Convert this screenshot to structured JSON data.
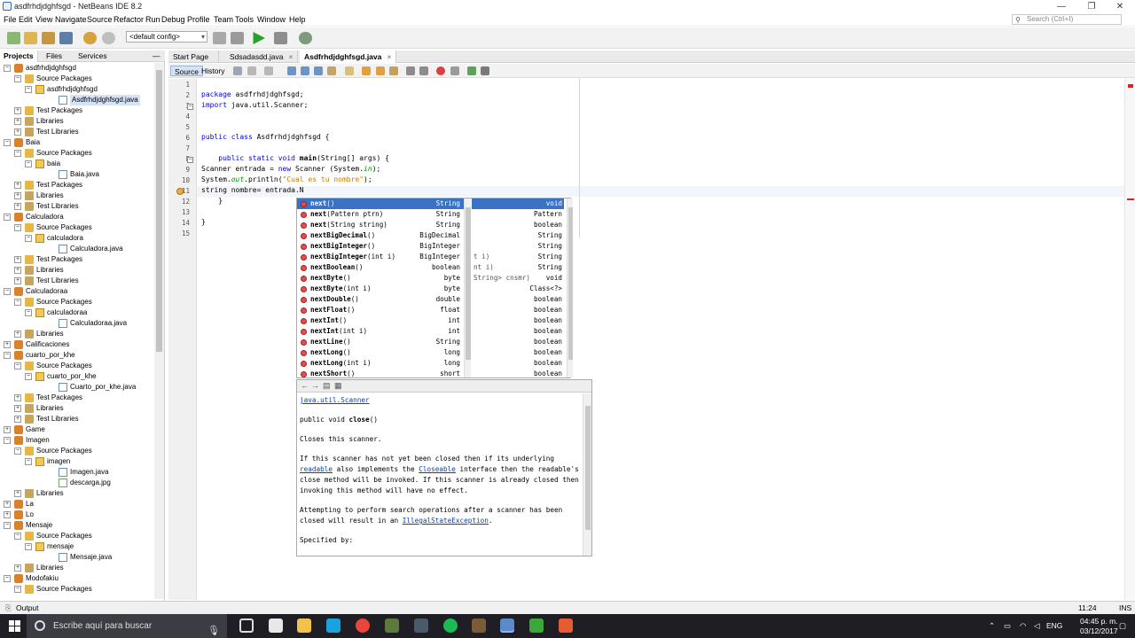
{
  "window": {
    "title": "asdfrhdjdghfsgd - NetBeans IDE 8.2",
    "minimize": "—",
    "maximize": "❐",
    "close": "✕"
  },
  "menu": [
    "File",
    "Edit",
    "View",
    "Navigate",
    "Source",
    "Refactor",
    "Run",
    "Debug",
    "Profile",
    "Team",
    "Tools",
    "Window",
    "Help"
  ],
  "search": {
    "placeholder": "Search (Ctrl+I)"
  },
  "toolbar": {
    "config": "<default config>"
  },
  "left_tabs": [
    "Projects",
    "Files",
    "Services"
  ],
  "left_tabs_close": "—",
  "tree": [
    {
      "label": "asdfrhdjdghfsgd",
      "icon": "proj",
      "toggle": "−"
    },
    {
      "label": "Source Packages",
      "icon": "pkgs",
      "toggle": "−"
    },
    {
      "label": "asdfrhdjdghfsgd",
      "icon": "pkg",
      "toggle": "−"
    },
    {
      "label": "Asdfrhdjdghfsgd.java",
      "icon": "java",
      "selected": true
    },
    {
      "label": "Test Packages",
      "icon": "pkgs",
      "toggle": "+"
    },
    {
      "label": "Libraries",
      "icon": "lib",
      "toggle": "+"
    },
    {
      "label": "Test Libraries",
      "icon": "lib",
      "toggle": "+"
    },
    {
      "label": "Baia",
      "icon": "proj",
      "toggle": "−"
    },
    {
      "label": "Source Packages",
      "icon": "pkgs",
      "toggle": "−"
    },
    {
      "label": "baia",
      "icon": "pkg",
      "toggle": "−"
    },
    {
      "label": "Baia.java",
      "icon": "java"
    },
    {
      "label": "Test Packages",
      "icon": "pkgs",
      "toggle": "+"
    },
    {
      "label": "Libraries",
      "icon": "lib",
      "toggle": "+"
    },
    {
      "label": "Test Libraries",
      "icon": "lib",
      "toggle": "+"
    },
    {
      "label": "Calculadora",
      "icon": "proj",
      "toggle": "−"
    },
    {
      "label": "Source Packages",
      "icon": "pkgs",
      "toggle": "−"
    },
    {
      "label": "calculadora",
      "icon": "pkg",
      "toggle": "−"
    },
    {
      "label": "Calculadora.java",
      "icon": "java"
    },
    {
      "label": "Test Packages",
      "icon": "pkgs",
      "toggle": "+"
    },
    {
      "label": "Libraries",
      "icon": "lib",
      "toggle": "+"
    },
    {
      "label": "Test Libraries",
      "icon": "lib",
      "toggle": "+"
    },
    {
      "label": "Calculadoraa",
      "icon": "proj",
      "toggle": "−"
    },
    {
      "label": "Source Packages",
      "icon": "pkgs",
      "toggle": "−"
    },
    {
      "label": "calculadoraa",
      "icon": "pkg",
      "toggle": "−"
    },
    {
      "label": "Calculadoraa.java",
      "icon": "java"
    },
    {
      "label": "Libraries",
      "icon": "lib",
      "toggle": "+"
    },
    {
      "label": "Calificaciones",
      "icon": "proj",
      "toggle": "+"
    },
    {
      "label": "cuarto_por_khe",
      "icon": "proj",
      "toggle": "−"
    },
    {
      "label": "Source Packages",
      "icon": "pkgs",
      "toggle": "−"
    },
    {
      "label": "cuarto_por_khe",
      "icon": "pkg",
      "toggle": "−"
    },
    {
      "label": "Cuarto_por_khe.java",
      "icon": "java"
    },
    {
      "label": "Test Packages",
      "icon": "pkgs",
      "toggle": "+"
    },
    {
      "label": "Libraries",
      "icon": "lib",
      "toggle": "+"
    },
    {
      "label": "Test Libraries",
      "icon": "lib",
      "toggle": "+"
    },
    {
      "label": "Game",
      "icon": "proj",
      "toggle": "+"
    },
    {
      "label": "Imagen",
      "icon": "proj",
      "toggle": "−"
    },
    {
      "label": "Source Packages",
      "icon": "pkgs",
      "toggle": "−"
    },
    {
      "label": "imagen",
      "icon": "pkg",
      "toggle": "−"
    },
    {
      "label": "Imagen.java",
      "icon": "java"
    },
    {
      "label": "descarga.jpg",
      "icon": "img"
    },
    {
      "label": "Libraries",
      "icon": "lib",
      "toggle": "+"
    },
    {
      "label": "La",
      "icon": "proj",
      "toggle": "+"
    },
    {
      "label": "Lo",
      "icon": "proj",
      "toggle": "+"
    },
    {
      "label": "Mensaje",
      "icon": "proj",
      "toggle": "−"
    },
    {
      "label": "Source Packages",
      "icon": "pkgs",
      "toggle": "−"
    },
    {
      "label": "mensaje",
      "icon": "pkg",
      "toggle": "−"
    },
    {
      "label": "Mensaje.java",
      "icon": "java"
    },
    {
      "label": "Libraries",
      "icon": "lib",
      "toggle": "+"
    },
    {
      "label": "Modofakiu",
      "icon": "proj",
      "toggle": "−"
    },
    {
      "label": "Source Packages",
      "icon": "pkgs",
      "toggle": "−"
    }
  ],
  "editor_tabs": [
    {
      "label": "Start Page",
      "active": false,
      "close": ""
    },
    {
      "label": "Sdsadasdd.java",
      "active": false,
      "close": "×"
    },
    {
      "label": "Asdfrhdjdghfsgd.java",
      "active": true,
      "close": "×"
    }
  ],
  "editor_subtabs": [
    "Source",
    "History"
  ],
  "code_lines": [
    {
      "n": "1",
      "html": ""
    },
    {
      "n": "2",
      "html": "<span class=\"kw\">package</span> asdfrhdjdghfsgd;"
    },
    {
      "n": "3",
      "html": "<span class=\"kw\">import</span> java.util.Scanner;",
      "fold": "−"
    },
    {
      "n": "4",
      "html": ""
    },
    {
      "n": "5",
      "html": ""
    },
    {
      "n": "6",
      "html": "<span class=\"kw\">public class</span> Asdfrhdjdghfsgd {"
    },
    {
      "n": "7",
      "html": ""
    },
    {
      "n": "8",
      "html": "    <span class=\"kw\">public static void</span> <b>main</b>(String[] args) {",
      "fold": "−"
    },
    {
      "n": "9",
      "html": "Scanner entrada = <span class=\"kw\">new</span> Scanner (System.<span class=\"fld\">in</span>);"
    },
    {
      "n": "10",
      "html": "System.<span class=\"fld\">out</span>.println(<span class=\"str\">\"Cual es tu nombre\"</span>);"
    },
    {
      "n": "11",
      "html": "string nombre= entrada.N",
      "current": true
    },
    {
      "n": "12",
      "html": "    }"
    },
    {
      "n": "13",
      "html": ""
    },
    {
      "n": "14",
      "html": "}"
    },
    {
      "n": "15",
      "html": ""
    }
  ],
  "completion": [
    {
      "name": "next",
      "params": "()",
      "type": "String",
      "selected": true
    },
    {
      "name": "next",
      "params": "(Pattern ptrn)",
      "type": "String"
    },
    {
      "name": "next",
      "params": "(String string)",
      "type": "String"
    },
    {
      "name": "nextBigDecimal",
      "params": "()",
      "type": "BigDecimal"
    },
    {
      "name": "nextBigInteger",
      "params": "()",
      "type": "BigInteger"
    },
    {
      "name": "nextBigInteger",
      "params": "(int i)",
      "type": "BigInteger"
    },
    {
      "name": "nextBoolean",
      "params": "()",
      "type": "boolean"
    },
    {
      "name": "nextByte",
      "params": "()",
      "type": "byte"
    },
    {
      "name": "nextByte",
      "params": "(int i)",
      "type": "byte"
    },
    {
      "name": "nextDouble",
      "params": "()",
      "type": "double"
    },
    {
      "name": "nextFloat",
      "params": "()",
      "type": "float"
    },
    {
      "name": "nextInt",
      "params": "()",
      "type": "int"
    },
    {
      "name": "nextInt",
      "params": "(int i)",
      "type": "int"
    },
    {
      "name": "nextLine",
      "params": "()",
      "type": "String"
    },
    {
      "name": "nextLong",
      "params": "()",
      "type": "long"
    },
    {
      "name": "nextLong",
      "params": "(int i)",
      "type": "long"
    },
    {
      "name": "nextShort",
      "params": "()",
      "type": "short"
    }
  ],
  "completion_right": [
    {
      "left": "",
      "right": "void",
      "selected": true
    },
    {
      "left": "",
      "right": "Pattern"
    },
    {
      "left": "",
      "right": "boolean"
    },
    {
      "left": "",
      "right": "String"
    },
    {
      "left": "",
      "right": "String"
    },
    {
      "left": "t i)",
      "right": "String"
    },
    {
      "left": "nt i)",
      "right": "String"
    },
    {
      "left": "String> cnsmr)",
      "right": "void"
    },
    {
      "left": "",
      "right": "Class<?>"
    },
    {
      "left": "",
      "right": "boolean"
    },
    {
      "left": "",
      "right": "boolean"
    },
    {
      "left": "",
      "right": "boolean"
    },
    {
      "left": "",
      "right": "boolean"
    },
    {
      "left": "",
      "right": "boolean"
    },
    {
      "left": "",
      "right": "boolean"
    },
    {
      "left": "",
      "right": "boolean"
    },
    {
      "left": "",
      "right": "boolean"
    }
  ],
  "doc": {
    "nav": [
      "←",
      "→",
      "▤",
      "▦"
    ],
    "class_link": "java.util.Scanner",
    "signature_pre": "public void ",
    "signature_method": "close",
    "signature_post": "()",
    "summary": "Closes this scanner.",
    "p1_a": "If this scanner has not yet been closed then if its underlying ",
    "p1_link1": "readable",
    "p1_b": " also implements the ",
    "p1_link2": "Closeable",
    "p1_c": " interface then the readable's close method will be invoked. If this scanner is already closed then invoking this method will have no effect.",
    "p2_a": "Attempting to perform search operations after a scanner has been closed will result in an ",
    "p2_link": "IllegalStateException",
    "p2_b": ".",
    "specified": "Specified by:"
  },
  "status": {
    "output": "Output",
    "position": "11:24",
    "mode": "INS"
  },
  "taskbar": {
    "search": "Escribe aquí para buscar",
    "lang": "ENG",
    "time": "04:45 p. m.",
    "date": "03/12/2017"
  },
  "colors": {
    "selection": "#3a72c4",
    "keyword": "#0000e6",
    "string": "#ce7b00",
    "accent_project": "#d9822b"
  }
}
